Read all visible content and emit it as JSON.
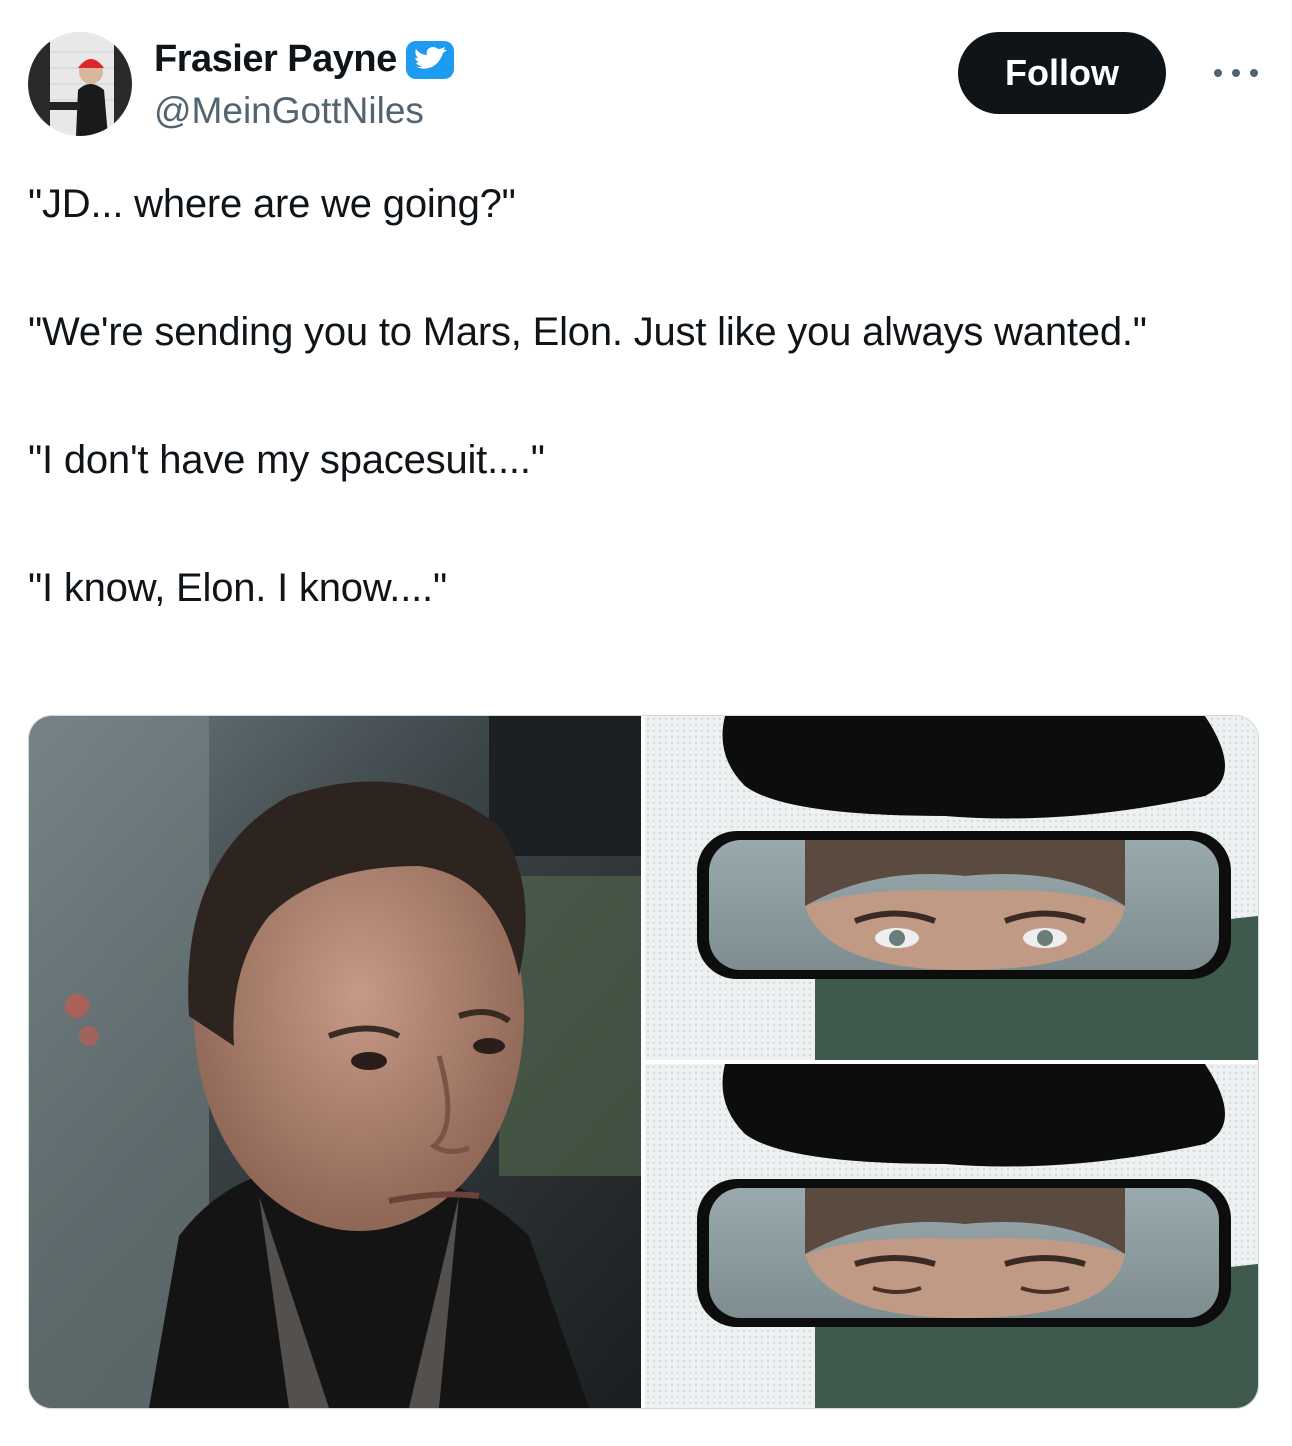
{
  "author": {
    "display_name": "Frasier Payne",
    "handle": "@MeinGottNiles",
    "avatar_icon": "avatar-image",
    "verified_icon": "verified-badge-icon",
    "verified_color": "#1d9bf0"
  },
  "actions": {
    "follow_label": "Follow",
    "more_icon": "more-options-icon"
  },
  "tweet": {
    "text": "\"JD... where are we going?\"\n\n\"We're sending you to Mars, Elon. Just like you always wanted.\"\n\n\"I don't have my spacesuit....\"\n\n\"I know, Elon. I know....\""
  },
  "media": {
    "count": 3,
    "images": [
      {
        "name": "man-in-car-photo"
      },
      {
        "name": "rearview-mirror-eyes-open"
      },
      {
        "name": "rearview-mirror-eyes-closed"
      }
    ]
  },
  "colors": {
    "text_primary": "#0f1419",
    "text_secondary": "#536471",
    "button_bg": "#0f1419",
    "button_text": "#ffffff"
  }
}
